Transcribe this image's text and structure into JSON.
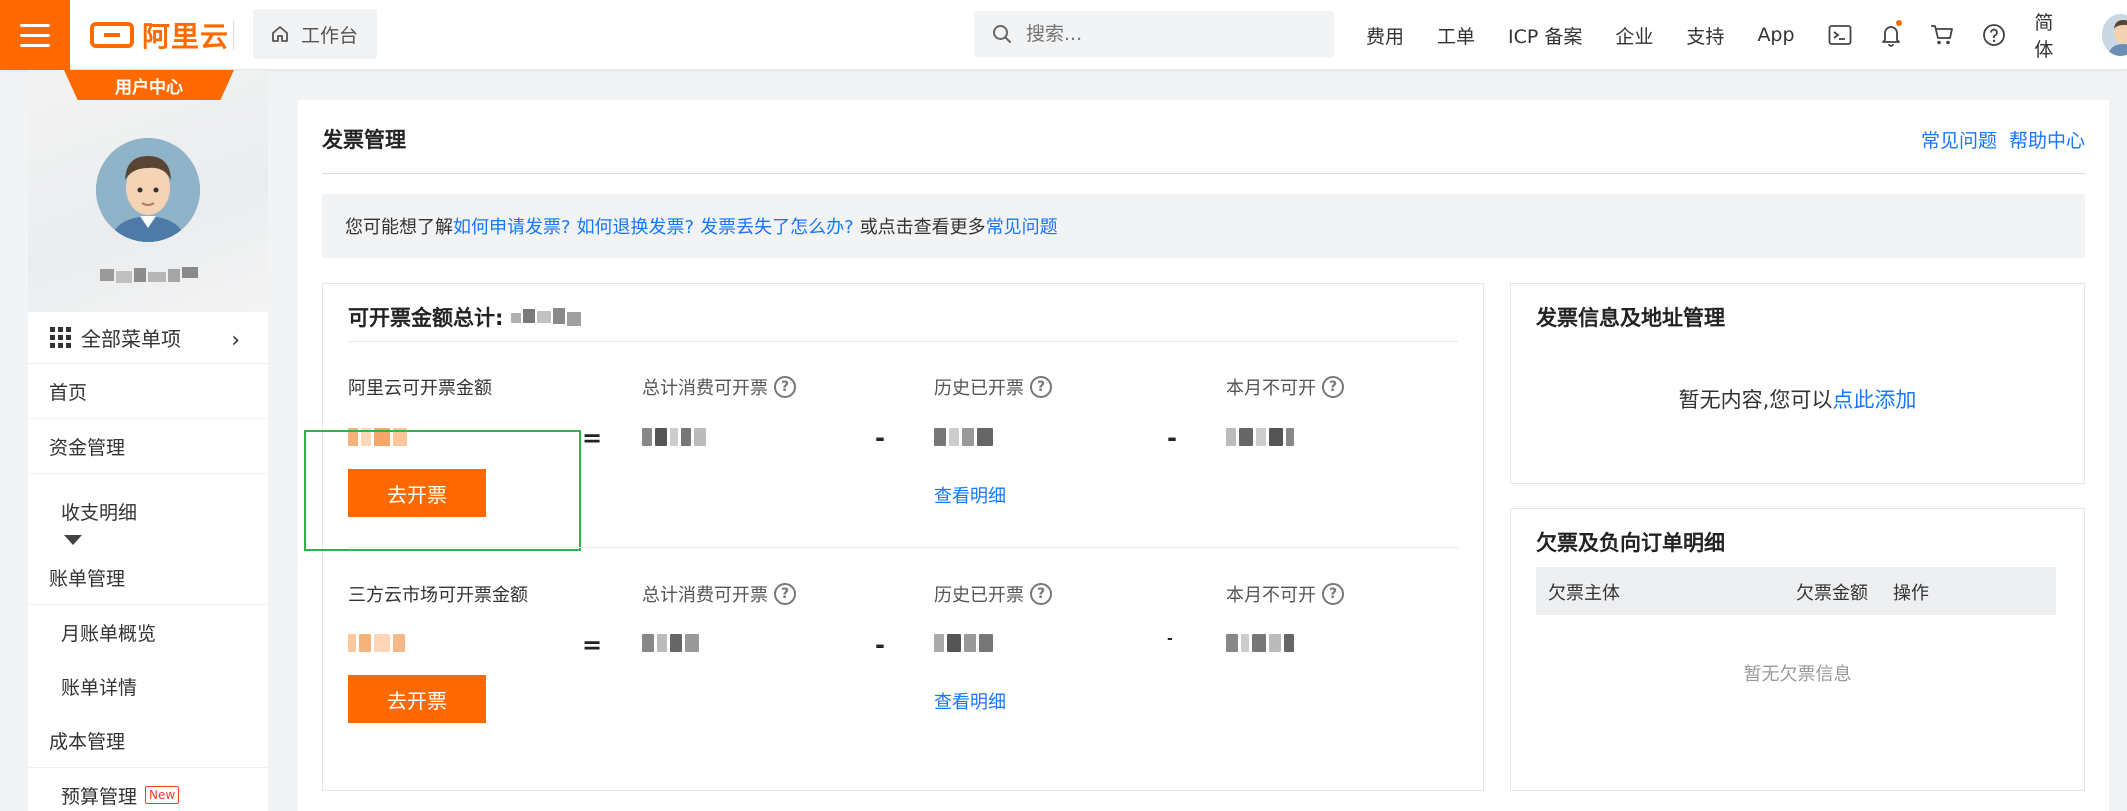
{
  "topbar": {
    "brand": "阿里云",
    "workbench": "工作台",
    "search_placeholder": "搜索...",
    "nav": [
      "费用",
      "工单",
      "ICP 备案",
      "企业",
      "支持",
      "App"
    ],
    "language": "简体",
    "icons": [
      "terminal-icon",
      "bell-icon",
      "cart-icon",
      "help-icon"
    ],
    "accent_color": "#ff6a00"
  },
  "sidebar": {
    "user_center": "用户中心",
    "all_menu": "全部菜单项",
    "items": [
      {
        "label": "首页"
      },
      {
        "label": "资金管理"
      },
      {
        "label": "收支明细"
      },
      {
        "label": "账单管理"
      },
      {
        "label": "月账单概览"
      },
      {
        "label": "账单详情"
      },
      {
        "label": "成本管理"
      },
      {
        "label": "预算管理"
      }
    ],
    "new_badge": "New"
  },
  "main": {
    "title": "发票管理",
    "links": [
      "常见问题",
      "帮助中心"
    ],
    "tip": {
      "prefix": "您可能想了解",
      "links": [
        "如何申请发票?",
        "如何退换发票?",
        "发票丢失了怎么办?"
      ],
      "middle": "或点击查看更多",
      "more_link": "常见问题"
    },
    "invoice": {
      "total_label": "可开票金额总计:",
      "rows": [
        {
          "label": "阿里云可开票金额",
          "col2": "总计消费可开票",
          "col3": "历史已开票",
          "col4": "本月不可开",
          "detail": "查看明细",
          "button": "去开票"
        },
        {
          "label": "三方云市场可开票金额",
          "col2": "总计消费可开票",
          "col3": "历史已开票",
          "col4": "本月不可开",
          "detail": "查看明细",
          "button": "去开票"
        }
      ],
      "ops": [
        "=",
        "-",
        "-"
      ]
    },
    "info": {
      "title": "发票信息及地址管理",
      "empty_prefix": "暂无内容,您可以",
      "empty_link": "点此添加"
    },
    "owe": {
      "title": "欠票及负向订单明细",
      "columns": [
        "欠票主体",
        "欠票金额",
        "操作"
      ],
      "empty": "暂无欠票信息"
    }
  }
}
